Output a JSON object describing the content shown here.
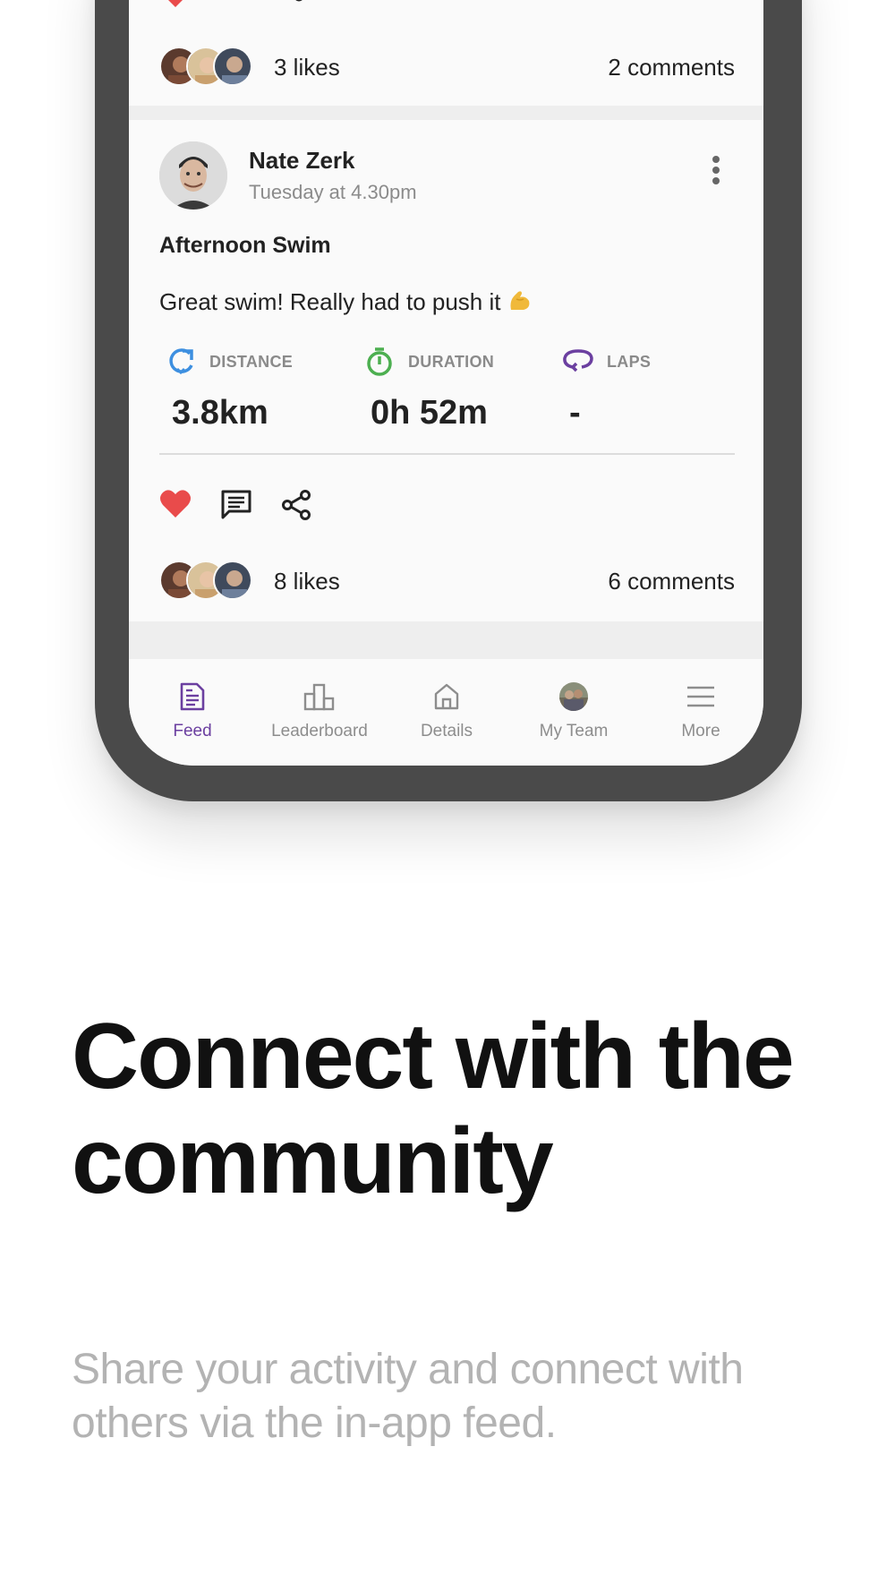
{
  "previous_post": {
    "likes": "3 likes",
    "comments": "2 comments"
  },
  "post": {
    "author": "Nate Zerk",
    "time": "Tuesday at 4.30pm",
    "title": "Afternoon Swim",
    "body": "Great swim! Really had to push it",
    "stats": [
      {
        "label": "DISTANCE",
        "value": "3.8km",
        "icon": "distance-icon",
        "color": "#3d8fe0"
      },
      {
        "label": "DURATION",
        "value": "0h 52m",
        "icon": "stopwatch-icon",
        "color": "#4caf50"
      },
      {
        "label": "LAPS",
        "value": "-",
        "icon": "laps-icon",
        "color": "#6b3fa0"
      }
    ],
    "likes": "8 likes",
    "comments": "6 comments"
  },
  "tabbar": {
    "items": [
      {
        "label": "Feed",
        "icon": "feed-icon",
        "active": true
      },
      {
        "label": "Leaderboard",
        "icon": "leaderboard-icon",
        "active": false
      },
      {
        "label": "Details",
        "icon": "home-icon",
        "active": false
      },
      {
        "label": "My Team",
        "icon": "team-avatar",
        "active": false
      },
      {
        "label": "More",
        "icon": "menu-icon",
        "active": false
      }
    ]
  },
  "marketing": {
    "headline": "Connect with the community",
    "subtext": "Share your activity and connect with others via the in-app feed."
  },
  "colors": {
    "accent": "#6b3fa0",
    "heart": "#e94b4b",
    "frame": "#4a4a4a"
  }
}
